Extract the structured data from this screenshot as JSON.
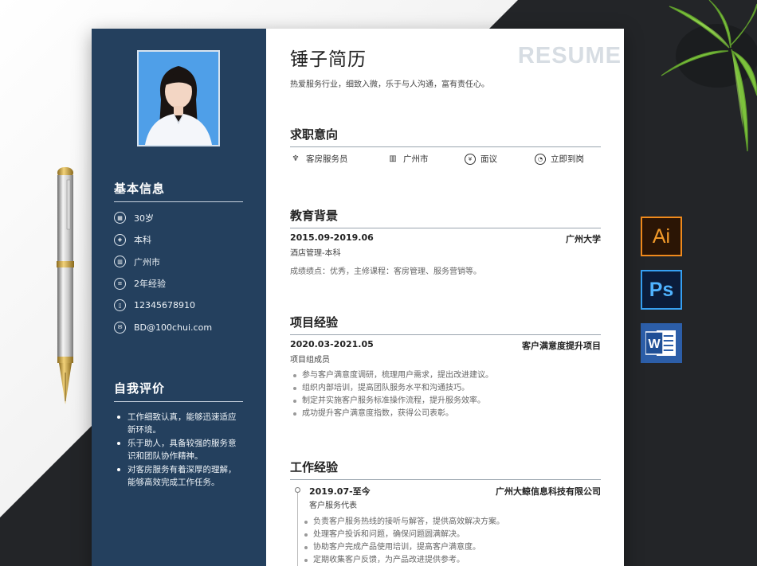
{
  "resume": {
    "name": "锤子简历",
    "watermark": "RESUME",
    "tagline": "热爱服务行业，细致入微，乐于与人沟通，富有责任心。"
  },
  "sidebar": {
    "basic_title": "基本信息",
    "basic_items": [
      {
        "icon": "calendar-icon",
        "text": "30岁"
      },
      {
        "icon": "graduation-cap-icon",
        "text": "本科"
      },
      {
        "icon": "building-icon",
        "text": "广州市"
      },
      {
        "icon": "document-icon",
        "text": "2年经验"
      },
      {
        "icon": "phone-icon",
        "text": "12345678910"
      },
      {
        "icon": "mail-icon",
        "text": "BD@100chui.com"
      }
    ],
    "self_eval_title": "自我评价",
    "self_eval_items": [
      "工作细致认真，能够迅速适应新环境。",
      "乐于助人，具备较强的服务意识和团队协作精神。",
      "对客房服务有着深厚的理解，能够高效完成工作任务。"
    ]
  },
  "intent": {
    "title": "求职意向",
    "items": [
      {
        "icon": "tie-icon",
        "text": "客房服务员"
      },
      {
        "icon": "building-icon",
        "text": "广州市"
      },
      {
        "icon": "yen-icon",
        "text": "面议"
      },
      {
        "icon": "clock-icon",
        "text": "立即到岗"
      }
    ]
  },
  "education": {
    "title": "教育背景",
    "period": "2015.09-2019.06",
    "school": "广州大学",
    "major": "酒店管理-本科",
    "note": "成绩绩点：优秀，主修课程：客房管理、服务营销等。"
  },
  "project": {
    "title": "项目经验",
    "period": "2020.03-2021.05",
    "name": "客户满意度提升项目",
    "role": "项目组成员",
    "bullets": [
      "参与客户满意度调研，梳理用户需求，提出改进建议。",
      "组织内部培训，提高团队服务水平和沟通技巧。",
      "制定并实施客户服务标准操作流程，提升服务效率。",
      "成功提升客户满意度指数，获得公司表彰。"
    ]
  },
  "work": {
    "title": "工作经验",
    "period": "2019.07-至今",
    "company": "广州大鲸信息科技有限公司",
    "role": "客户服务代表",
    "bullets": [
      "负责客户服务热线的接听与解答，提供高效解决方案。",
      "处理客户投诉和问题，确保问题圆满解决。",
      "协助客户完成产品使用培训，提高客户满意度。",
      "定期收集客户反馈，为产品改进提供参考。"
    ]
  },
  "software": {
    "ai_label": "Ai",
    "ps_label": "Ps",
    "word_label": "W"
  },
  "colors": {
    "sidebar": "#24405e",
    "ai_orange": "#f08a1c",
    "ps_blue": "#36a0f2",
    "word_blue": "#2c5ea8"
  }
}
